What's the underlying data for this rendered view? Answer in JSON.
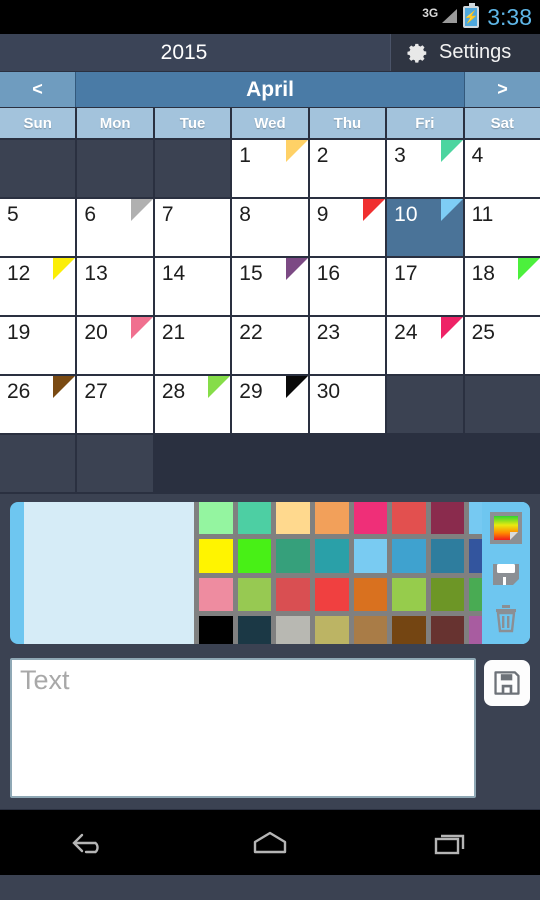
{
  "statusbar": {
    "network": "3G",
    "signal_icon": "signal-triangle-icon",
    "battery_icon": "battery-charging-icon",
    "bolt_glyph": "⚡",
    "time": "3:38",
    "time_color": "#5fb7e8"
  },
  "titlebar": {
    "year": "2015",
    "settings_label": "Settings",
    "settings_icon": "gear-icon"
  },
  "monthbar": {
    "prev_label": "<",
    "next_label": ">",
    "month": "April"
  },
  "weekdays": [
    "Sun",
    "Mon",
    "Tue",
    "Wed",
    "Thu",
    "Fri",
    "Sat"
  ],
  "calendar": {
    "year": "2015",
    "month": "April",
    "first_weekday_index": 3,
    "selected_day": 10,
    "leading_blanks": 3,
    "trailing_blanks": 4,
    "days": [
      {
        "num": "1",
        "marker": "#ffd166"
      },
      {
        "num": "2",
        "marker": null
      },
      {
        "num": "3",
        "marker": "#4cd5a0"
      },
      {
        "num": "4",
        "marker": null
      },
      {
        "num": "5",
        "marker": null
      },
      {
        "num": "6",
        "marker": "#b0b0b0"
      },
      {
        "num": "7",
        "marker": null
      },
      {
        "num": "8",
        "marker": null
      },
      {
        "num": "9",
        "marker": "#f03030"
      },
      {
        "num": "10",
        "marker": "#7ecdf5",
        "selected": true
      },
      {
        "num": "11",
        "marker": null
      },
      {
        "num": "12",
        "marker": "#fbee07"
      },
      {
        "num": "13",
        "marker": null
      },
      {
        "num": "14",
        "marker": null
      },
      {
        "num": "15",
        "marker": "#7c4a84"
      },
      {
        "num": "16",
        "marker": null
      },
      {
        "num": "17",
        "marker": null
      },
      {
        "num": "18",
        "marker": "#4cf03c"
      },
      {
        "num": "19",
        "marker": null
      },
      {
        "num": "20",
        "marker": "#f0708f"
      },
      {
        "num": "21",
        "marker": null
      },
      {
        "num": "22",
        "marker": null
      },
      {
        "num": "23",
        "marker": null
      },
      {
        "num": "24",
        "marker": "#ee2266"
      },
      {
        "num": "25",
        "marker": null
      },
      {
        "num": "26",
        "marker": "#7a4a12"
      },
      {
        "num": "27",
        "marker": null
      },
      {
        "num": "28",
        "marker": "#86dd49"
      },
      {
        "num": "29",
        "marker": "#0a0a0a"
      },
      {
        "num": "30",
        "marker": null
      }
    ]
  },
  "editor": {
    "preview_color": "#d6ecf7",
    "card_color": "#6ec6f0",
    "palette_bg": "#808080",
    "palette_rows": [
      [
        "#94f5a0",
        "#4dcfa3",
        "#ffd98e",
        "#f2a05a",
        "#ef2f78",
        "#e2504f",
        "#8a2b4d",
        "#76c9f2"
      ],
      [
        "#fff400",
        "#48f016",
        "#36a07b",
        "#2aa0a8",
        "#79cbf2",
        "#3fa2cf",
        "#2e7d9e",
        "#33559e"
      ],
      [
        "#ee8ca0",
        "#97c952",
        "#d94f52",
        "#f04040",
        "#d9711f",
        "#96cc4c",
        "#6d9626",
        "#49ab53"
      ],
      [
        "#000000",
        "#1b3845",
        "#b8b8b2",
        "#bcb464",
        "#a97c47",
        "#744512",
        "#673330",
        "#a85ca0"
      ]
    ],
    "tools": [
      {
        "name": "color-picker-icon",
        "label": "Pick color"
      },
      {
        "name": "save-icon",
        "label": "Save"
      },
      {
        "name": "trash-icon",
        "label": "Delete"
      }
    ]
  },
  "note": {
    "placeholder": "Text",
    "value": "",
    "save_icon": "save-icon"
  },
  "navbar": {
    "back_icon": "back-arrow-icon",
    "home_icon": "home-icon",
    "recents_icon": "recent-apps-icon"
  }
}
